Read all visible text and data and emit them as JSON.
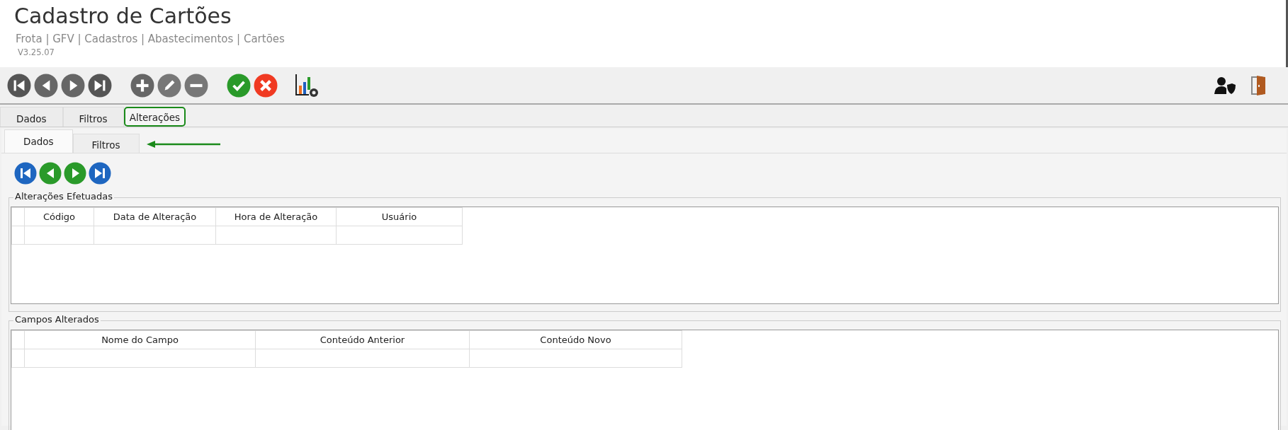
{
  "header": {
    "title": "Cadastro de Cartões",
    "breadcrumb": "Frota | GFV | Cadastros | Abastecimentos | Cartões",
    "version": "V3.25.07"
  },
  "tabs": [
    {
      "label": "Dados",
      "selected": false,
      "highlighted": false
    },
    {
      "label": "Filtros",
      "selected": false,
      "highlighted": false
    },
    {
      "label": "Alterações",
      "selected": true,
      "highlighted": true
    }
  ],
  "inner_tabs": [
    {
      "label": "Dados",
      "selected": true
    },
    {
      "label": "Filtros",
      "selected": false
    }
  ],
  "changes_group": {
    "title": "Alterações Efetuadas",
    "columns": [
      "Código",
      "Data de Alteração",
      "Hora de Alteração",
      "Usuário"
    ]
  },
  "fields_group": {
    "title": "Campos Alterados",
    "columns": [
      "Nome do Campo",
      "Conteúdo Anterior",
      "Conteúdo Novo"
    ]
  }
}
